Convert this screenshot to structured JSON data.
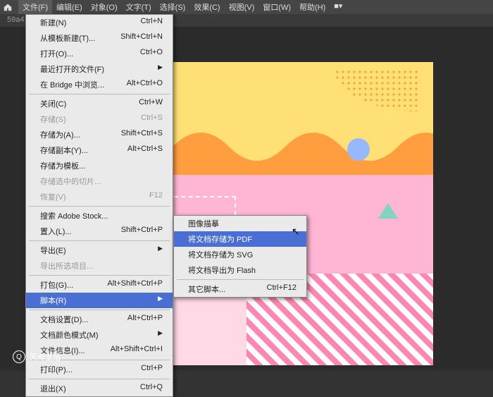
{
  "menubar": {
    "items": [
      "文件(F)",
      "编辑(E)",
      "对象(O)",
      "文字(T)",
      "选择(S)",
      "效果(C)",
      "视图(V)",
      "窗口(W)",
      "帮助(H)"
    ],
    "extra": "■▾"
  },
  "tab": "59a4...",
  "dropdown": [
    {
      "t": "item",
      "label": "新建(N)",
      "sc": "Ctrl+N"
    },
    {
      "t": "item",
      "label": "从模板新建(T)...",
      "sc": "Shift+Ctrl+N"
    },
    {
      "t": "item",
      "label": "打开(O)...",
      "sc": "Ctrl+O"
    },
    {
      "t": "item",
      "label": "最近打开的文件(F)",
      "sc": "",
      "sub": true
    },
    {
      "t": "item",
      "label": "在 Bridge 中浏览...",
      "sc": "Alt+Ctrl+O"
    },
    {
      "t": "sep"
    },
    {
      "t": "item",
      "label": "关闭(C)",
      "sc": "Ctrl+W"
    },
    {
      "t": "item",
      "label": "存储(S)",
      "sc": "Ctrl+S",
      "dis": true
    },
    {
      "t": "item",
      "label": "存储为(A)...",
      "sc": "Shift+Ctrl+S"
    },
    {
      "t": "item",
      "label": "存储副本(Y)...",
      "sc": "Alt+Ctrl+S"
    },
    {
      "t": "item",
      "label": "存储为模板...",
      "sc": ""
    },
    {
      "t": "item",
      "label": "存储选中的切片...",
      "sc": "",
      "dis": true
    },
    {
      "t": "item",
      "label": "恢复(V)",
      "sc": "F12",
      "dis": true
    },
    {
      "t": "sep"
    },
    {
      "t": "item",
      "label": "搜索 Adobe Stock...",
      "sc": ""
    },
    {
      "t": "item",
      "label": "置入(L)...",
      "sc": "Shift+Ctrl+P"
    },
    {
      "t": "sep"
    },
    {
      "t": "item",
      "label": "导出(E)",
      "sc": "",
      "sub": true
    },
    {
      "t": "item",
      "label": "导出所选项目...",
      "sc": "",
      "dis": true
    },
    {
      "t": "sep"
    },
    {
      "t": "item",
      "label": "打包(G)...",
      "sc": "Alt+Shift+Ctrl+P"
    },
    {
      "t": "item",
      "label": "脚本(R)",
      "sc": "",
      "sub": true,
      "hl": true
    },
    {
      "t": "sep"
    },
    {
      "t": "item",
      "label": "文档设置(D)...",
      "sc": "Alt+Ctrl+P"
    },
    {
      "t": "item",
      "label": "文档颜色模式(M)",
      "sc": "",
      "sub": true
    },
    {
      "t": "item",
      "label": "文件信息(I)...",
      "sc": "Alt+Shift+Ctrl+I"
    },
    {
      "t": "sep"
    },
    {
      "t": "item",
      "label": "打印(P)...",
      "sc": "Ctrl+P"
    },
    {
      "t": "sep"
    },
    {
      "t": "item",
      "label": "退出(X)",
      "sc": "Ctrl+Q"
    }
  ],
  "submenu": [
    {
      "label": "图像描摹",
      "sc": ""
    },
    {
      "label": "将文档存储为 PDF",
      "sc": "",
      "hl": true
    },
    {
      "label": "将文档存储为 SVG",
      "sc": ""
    },
    {
      "label": "将文档导出为 Flash",
      "sc": ""
    },
    {
      "t": "sep"
    },
    {
      "label": "其它脚本...",
      "sc": "Ctrl+F12"
    }
  ],
  "watermark": "天奇生活"
}
